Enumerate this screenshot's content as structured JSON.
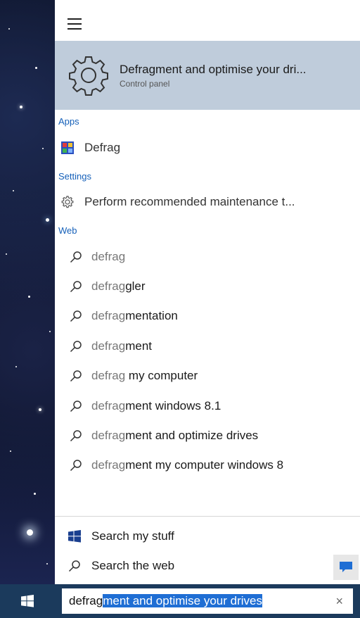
{
  "menu": {
    "hamburger": "menu"
  },
  "best_match": {
    "title_typed": "Defrag",
    "title_rest": "ment and optimise your dri...",
    "subtitle": "Control panel"
  },
  "sections": {
    "apps": "Apps",
    "settings": "Settings",
    "web": "Web"
  },
  "apps": [
    {
      "label": "Defrag"
    }
  ],
  "settings_items": [
    {
      "label": "Perform recommended maintenance t..."
    }
  ],
  "web_suggestions": [
    {
      "typed": "defrag",
      "completion": ""
    },
    {
      "typed": "defrag",
      "completion": "gler"
    },
    {
      "typed": "defrag",
      "completion": "mentation"
    },
    {
      "typed": "defrag",
      "completion": "ment"
    },
    {
      "typed": "defrag",
      "completion": " my computer"
    },
    {
      "typed": "defrag",
      "completion": "ment windows 8.1"
    },
    {
      "typed": "defrag",
      "completion": "ment and optimize drives"
    },
    {
      "typed": "defrag",
      "completion": "ment my computer windows 8"
    }
  ],
  "bottom": {
    "search_my_stuff": "Search my stuff",
    "search_web": "Search the web"
  },
  "searchbox": {
    "typed": "defrag",
    "selected_completion": "ment and optimise your drives",
    "clear": "×"
  },
  "colors": {
    "accent": "#1560b9",
    "highlight": "#bfccdb",
    "taskbar": "#1b3a5c",
    "selection": "#1f6ed4"
  }
}
